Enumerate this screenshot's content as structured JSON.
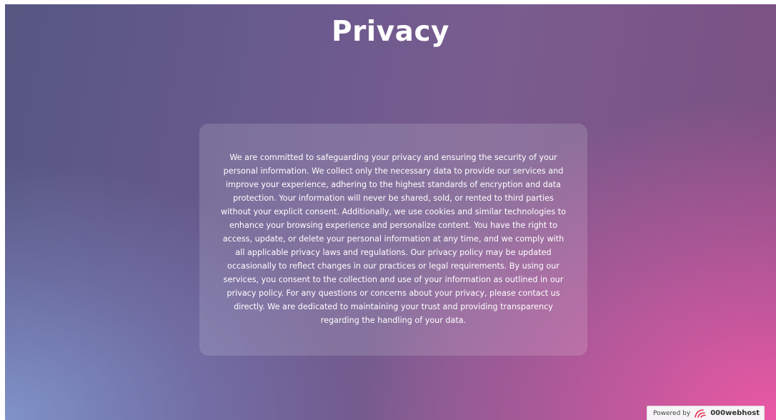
{
  "page": {
    "title": "Privacy",
    "body_text": "We are committed to safeguarding your privacy and ensuring the security of your personal information. We collect only the necessary data to provide our services and improve your experience, adhering to the highest standards of encryption and data protection. Your information will never be shared, sold, or rented to third parties without your explicit consent. Additionally, we use cookies and similar technologies to enhance your browsing experience and personalize content. You have the right to access, update, or delete your personal information at any time, and we comply with all applicable privacy laws and regulations. Our privacy policy may be updated occasionally to reflect changes in our practices or legal requirements. By using our services, you consent to the collection and use of your information as outlined in our privacy policy. For any questions or concerns about your privacy, please contact us directly. We are dedicated to maintaining your trust and providing transparency regarding the handling of your data."
  },
  "badge": {
    "label": "Powered by",
    "brand": "000webhost",
    "icon": "000webhost-logo-icon",
    "accent_color": "#e8304f"
  }
}
